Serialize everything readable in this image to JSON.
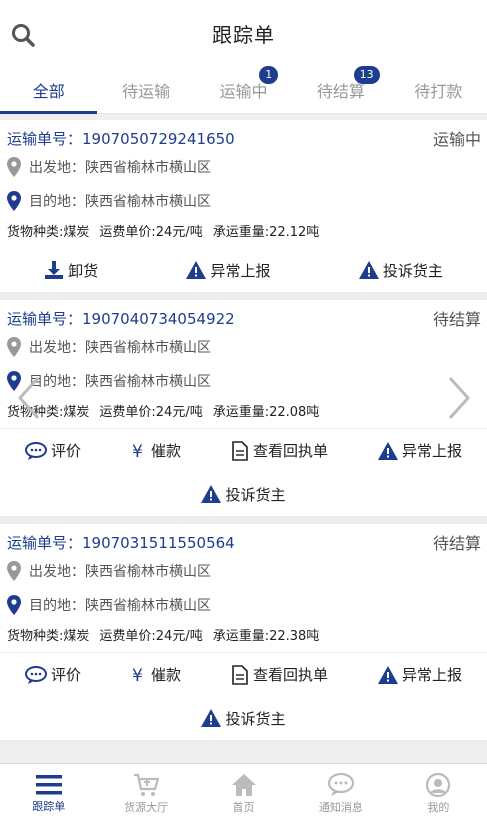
{
  "header": {
    "title": "跟踪单",
    "search_icon": "search-icon"
  },
  "tabs": [
    {
      "label": "全部",
      "active": true
    },
    {
      "label": "待运输"
    },
    {
      "label": "运输中",
      "badge": "1"
    },
    {
      "label": "待结算",
      "badge": "13"
    },
    {
      "label": "待打款"
    }
  ],
  "cards": [
    {
      "order": "运输单号：1907050729241650",
      "status": "运输中",
      "origin": "出发地：陕西省榆林市横山区",
      "destination": "目的地：陕西省榆林市横山区",
      "goods": "货物种类:煤炭",
      "price": "运费单价:24元/吨",
      "weight": "承运重量:22.12吨",
      "actions": [
        "卸货",
        "异常上报",
        "投诉货主"
      ]
    },
    {
      "order": "运输单号：1907040734054922",
      "status": "待结算",
      "origin": "出发地：陕西省榆林市横山区",
      "destination": "目的地：陕西省榆林市横山区",
      "goods": "货物种类:煤炭",
      "price": "运费单价:24元/吨",
      "weight": "承运重量:22.08吨",
      "actions": [
        "评价",
        "催款",
        "查看回执单",
        "异常上报"
      ],
      "extra_action": "投诉货主"
    },
    {
      "order": "运输单号：1907031511550564",
      "status": "待结算",
      "origin": "出发地：陕西省榆林市横山区",
      "destination": "目的地：陕西省榆林市横山区",
      "goods": "货物种类:煤炭",
      "price": "运费单价:24元/吨",
      "weight": "承运重量:22.38吨",
      "actions": [
        "评价",
        "催款",
        "查看回执单",
        "异常上报"
      ],
      "extra_action": "投诉货主"
    }
  ],
  "bottom_nav": [
    {
      "label": "跟踪单",
      "active": true
    },
    {
      "label": "货源大厅"
    },
    {
      "label": "首页"
    },
    {
      "label": "通知消息"
    },
    {
      "label": "我的"
    }
  ],
  "colors": {
    "accent": "#1e3d8f",
    "muted": "#999999"
  }
}
